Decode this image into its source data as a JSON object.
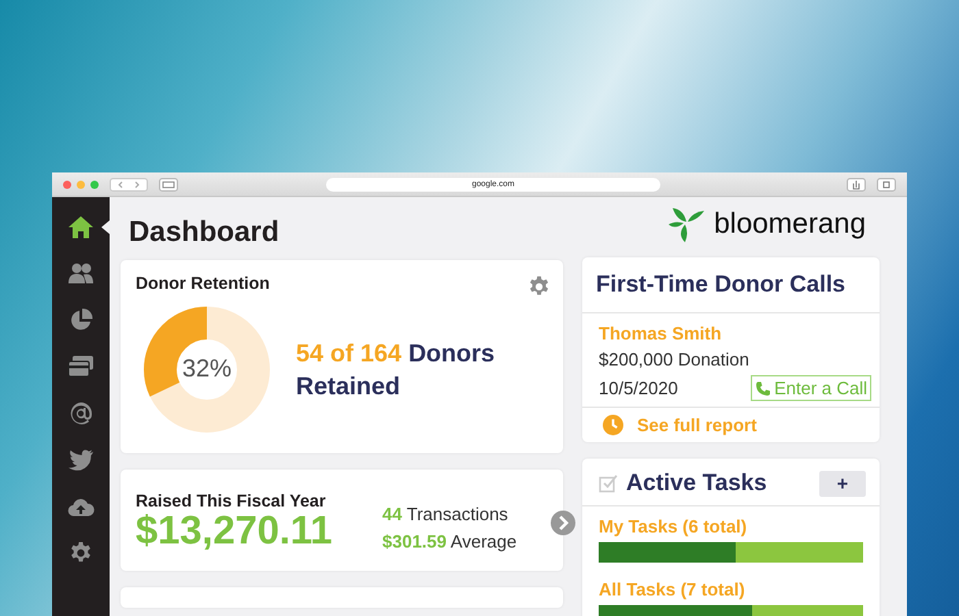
{
  "browser": {
    "url": "google.com"
  },
  "sidebar": {
    "items": [
      {
        "kind": "home",
        "selected": true
      },
      {
        "kind": "people",
        "selected": false
      },
      {
        "kind": "pie",
        "selected": false
      },
      {
        "kind": "cards",
        "selected": false
      },
      {
        "kind": "at",
        "selected": false
      },
      {
        "kind": "bird",
        "selected": false
      },
      {
        "kind": "cloud",
        "selected": false
      },
      {
        "kind": "gear",
        "selected": false
      }
    ]
  },
  "page": {
    "title": "Dashboard",
    "logo_text": "bloomerang"
  },
  "donor_retention": {
    "title": "Donor Retention",
    "percent": "32%",
    "level": 0.32,
    "count": "54 of 164",
    "label": "Donors Retained"
  },
  "raised": {
    "title": "Raised This Fiscal Year",
    "amount": "$13,270.11",
    "transactions_count": "44",
    "transactions_label": "Transactions",
    "average_value": "$301.59",
    "average_label": "Average"
  },
  "first_time_calls": {
    "title": "First-Time Donor Calls",
    "name": "Thomas Smith",
    "donation": "$200,000 Donation",
    "date": "10/5/2020",
    "call_button": "Enter a Call",
    "report_link": "See full report"
  },
  "active_tasks": {
    "title": "Active Tasks",
    "add_button": "+",
    "tasks": [
      {
        "label": "My Tasks (6 total)",
        "level": 0.52
      },
      {
        "label": "All Tasks (7 total)",
        "level": 0.58
      }
    ]
  }
}
